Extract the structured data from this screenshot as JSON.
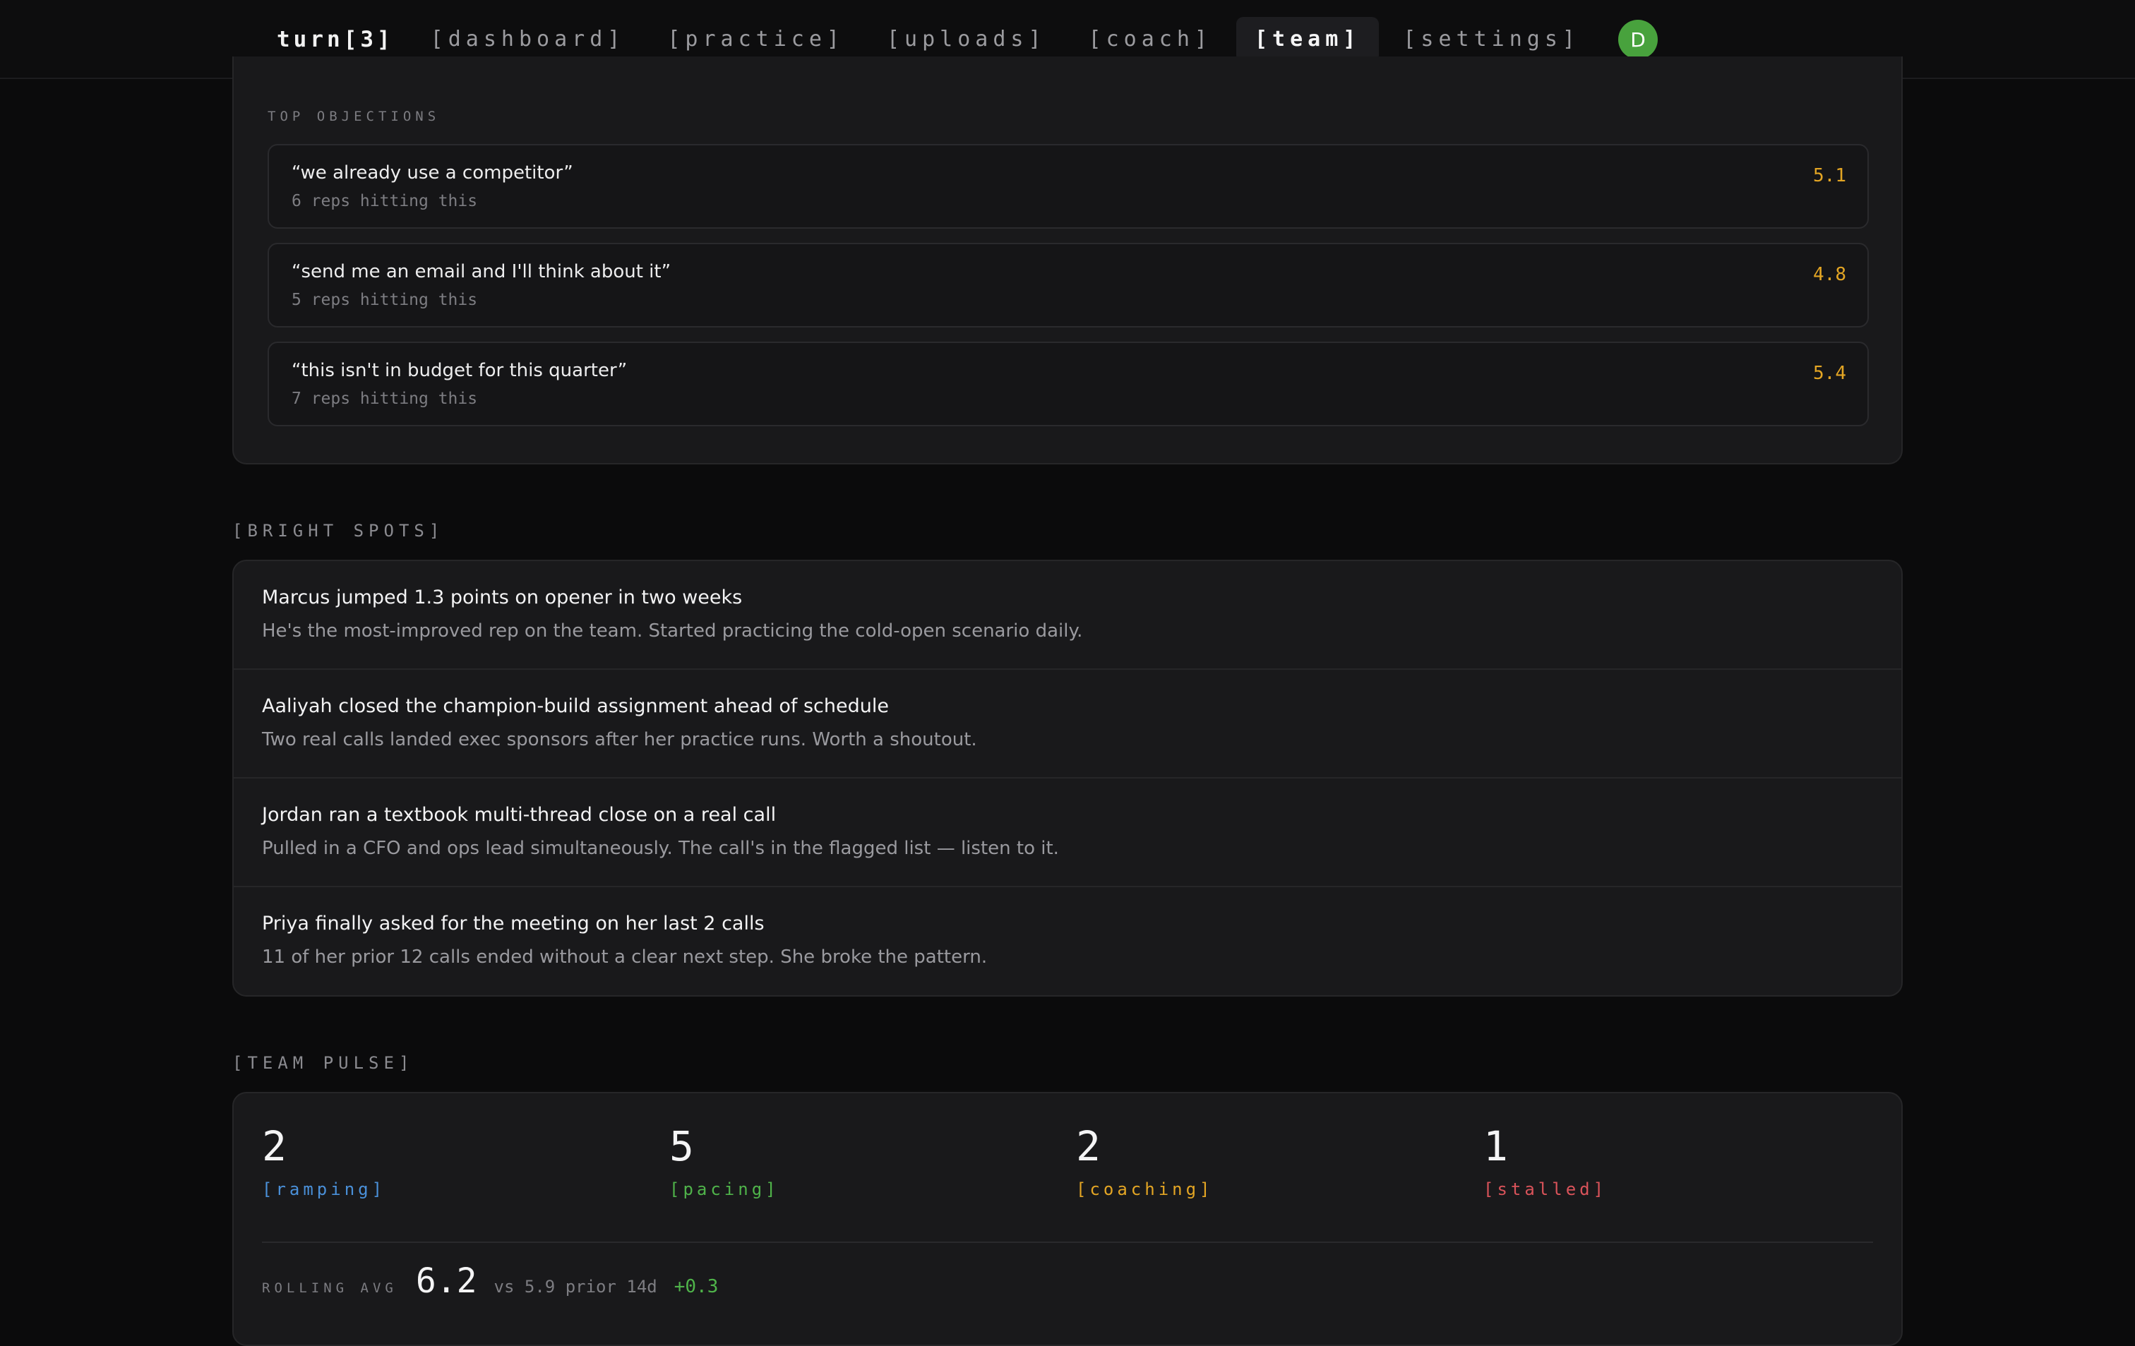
{
  "nav": {
    "brand": "turn[3]",
    "links": [
      {
        "label": "[dashboard]"
      },
      {
        "label": "[practice]"
      },
      {
        "label": "[uploads]"
      },
      {
        "label": "[coach]"
      },
      {
        "label": "[team]",
        "active": true
      },
      {
        "label": "[settings]"
      }
    ],
    "avatar_initial": "D"
  },
  "objections": {
    "title": "TOP OBJECTIONS",
    "items": [
      {
        "quote": "“we already use a competitor”",
        "sub": "6 reps hitting this",
        "score": "5.1"
      },
      {
        "quote": "“send me an email and I'll think about it”",
        "sub": "5 reps hitting this",
        "score": "4.8"
      },
      {
        "quote": "“this isn't in budget for this quarter”",
        "sub": "7 reps hitting this",
        "score": "5.4"
      }
    ]
  },
  "bright_spots": {
    "label": "[BRIGHT SPOTS]",
    "items": [
      {
        "title": "Marcus jumped 1.3 points on opener in two weeks",
        "desc": "He's the most-improved rep on the team. Started practicing the cold-open scenario daily."
      },
      {
        "title": "Aaliyah closed the champion-build assignment ahead of schedule",
        "desc": "Two real calls landed exec sponsors after her practice runs. Worth a shoutout."
      },
      {
        "title": "Jordan ran a textbook multi-thread close on a real call",
        "desc": "Pulled in a CFO and ops lead simultaneously. The call's in the flagged list — listen to it."
      },
      {
        "title": "Priya finally asked for the meeting on her last 2 calls",
        "desc": "11 of her prior 12 calls ended without a clear next step. She broke the pattern."
      }
    ]
  },
  "team_pulse": {
    "label": "[TEAM PULSE]",
    "stats": [
      {
        "value": "2",
        "label": "[ramping]",
        "color": "#4a90d9"
      },
      {
        "value": "5",
        "label": "[pacing]",
        "color": "#4fb34a"
      },
      {
        "value": "2",
        "label": "[coaching]",
        "color": "#e3a524"
      },
      {
        "value": "1",
        "label": "[stalled]",
        "color": "#d9535a"
      }
    ],
    "rolling": {
      "label": "ROLLING AVG",
      "value": "6.2",
      "compare": "vs 5.9 prior 14d",
      "delta": "+0.3"
    }
  }
}
